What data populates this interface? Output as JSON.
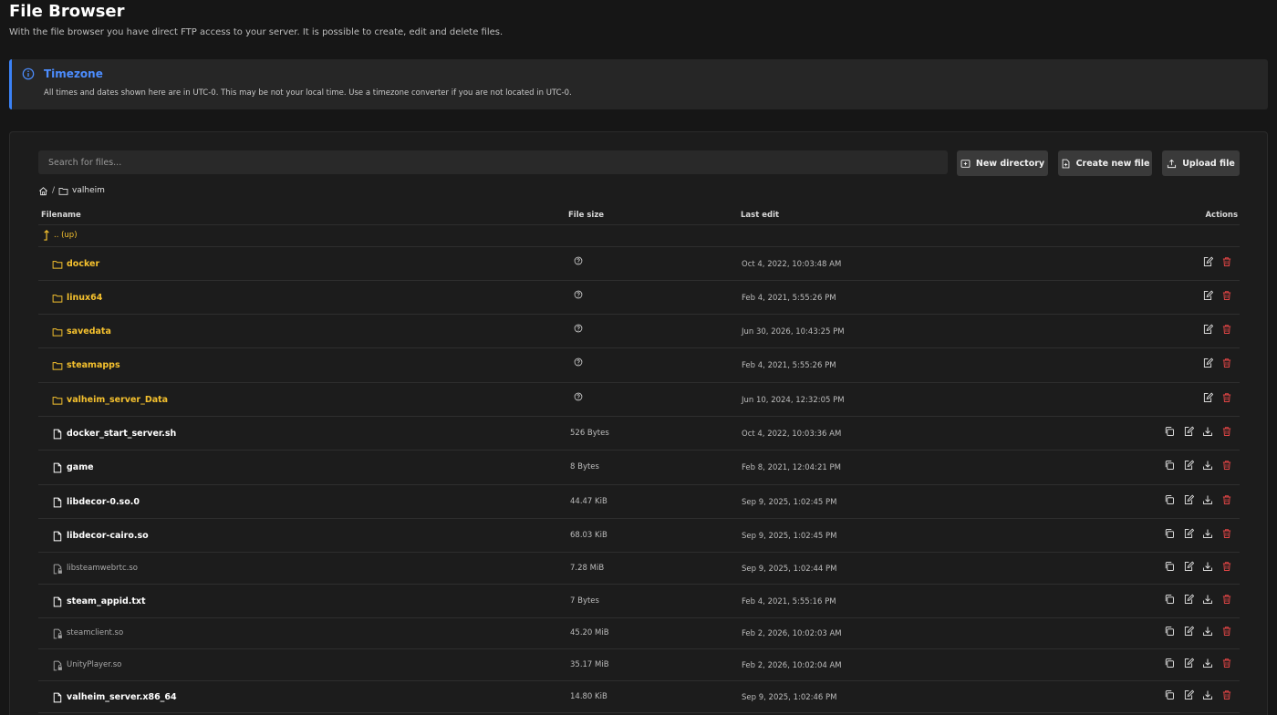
{
  "header": {
    "title": "File Browser",
    "subtitle": "With the file browser you have direct FTP access to your server. It is possible to create, edit and delete files."
  },
  "notice": {
    "title": "Timezone",
    "body": "All times and dates shown here are in UTC-0. This may be not your local time. Use a timezone converter if you are not located in UTC-0.",
    "accent_color": "#3b82f6"
  },
  "toolbar": {
    "search_placeholder": "Search for files...",
    "new_directory": "New directory",
    "create_new_file": "Create new file",
    "upload_file": "Upload file"
  },
  "breadcrumb": {
    "home_icon": "home-icon",
    "separator": "/",
    "current": "valheim"
  },
  "table": {
    "columns": {
      "filename": "Filename",
      "file_size": "File size",
      "last_edit": "Last edit",
      "actions": "Actions"
    },
    "up_label": ".. (up)",
    "rows": [
      {
        "type": "folder",
        "name": "docker",
        "size_icon": "question-circle-icon",
        "last_edit": "Oct 4, 2022, 10:03:48 AM"
      },
      {
        "type": "folder",
        "name": "linux64",
        "size_icon": "question-circle-icon",
        "last_edit": "Feb 4, 2021, 5:55:26 PM"
      },
      {
        "type": "folder",
        "name": "savedata",
        "size_icon": "question-circle-icon",
        "last_edit": "Jun 30, 2026, 10:43:25 PM"
      },
      {
        "type": "folder",
        "name": "steamapps",
        "size_icon": "question-circle-icon",
        "last_edit": "Feb 4, 2021, 5:55:26 PM"
      },
      {
        "type": "folder",
        "name": "valheim_server_Data",
        "size_icon": "question-circle-icon",
        "last_edit": "Jun 10, 2024, 12:32:05 PM"
      },
      {
        "type": "file",
        "name": "docker_start_server.sh",
        "size": "526 Bytes",
        "last_edit": "Oct 4, 2022, 10:03:36 AM"
      },
      {
        "type": "file",
        "name": "game",
        "size": "8 Bytes",
        "last_edit": "Feb 8, 2021, 12:04:21 PM"
      },
      {
        "type": "file",
        "name": "libdecor-0.so.0",
        "size": "44.47 KiB",
        "last_edit": "Sep 9, 2025, 1:02:45 PM"
      },
      {
        "type": "file",
        "name": "libdecor-cairo.so",
        "size": "68.03 KiB",
        "last_edit": "Sep 9, 2025, 1:02:45 PM"
      },
      {
        "type": "link",
        "name": "libsteamwebrtc.so",
        "size": "7.28 MiB",
        "last_edit": "Sep 9, 2025, 1:02:44 PM"
      },
      {
        "type": "file",
        "name": "steam_appid.txt",
        "size": "7 Bytes",
        "last_edit": "Feb 4, 2021, 5:55:16 PM"
      },
      {
        "type": "link",
        "name": "steamclient.so",
        "size": "45.20 MiB",
        "last_edit": "Feb 2, 2026, 10:02:03 AM"
      },
      {
        "type": "link",
        "name": "UnityPlayer.so",
        "size": "35.17 MiB",
        "last_edit": "Feb 2, 2026, 10:02:04 AM"
      },
      {
        "type": "file",
        "name": "valheim_server.x86_64",
        "size": "14.80 KiB",
        "last_edit": "Sep 9, 2025, 1:02:46 PM"
      }
    ]
  },
  "colors": {
    "folder": "#f5c12e",
    "delete": "#e04545",
    "info": "#4c8dff"
  }
}
